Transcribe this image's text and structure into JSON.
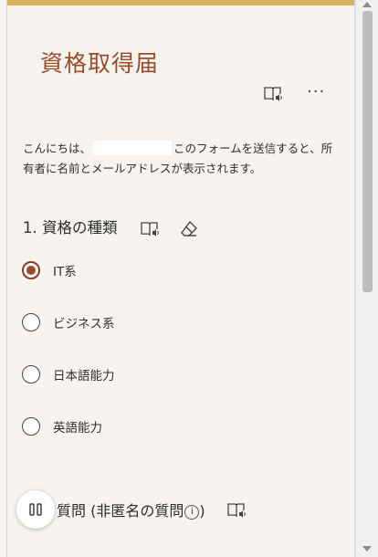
{
  "form": {
    "title": "資格取得届",
    "more_label": "···",
    "intro_prefix": "こんにちは、",
    "intro_suffix": "このフォームを送信すると、所有者に名前とメールアドレスが表示されます。"
  },
  "question1": {
    "title": "1. 資格の種類",
    "options": [
      {
        "label": "IT系",
        "selected": true
      },
      {
        "label": "ビジネス系",
        "selected": false
      },
      {
        "label": "日本語能力",
        "selected": false
      },
      {
        "label": "英語能力",
        "selected": false
      }
    ]
  },
  "question2": {
    "title": "質問 (非匿名の質問",
    "info_glyph": "i",
    "title_suffix": ")"
  },
  "colors": {
    "accent": "#d8b25a",
    "title": "#9a4c2a",
    "radio_selected": "#9a4c2a",
    "background": "#f7f4ef"
  },
  "icons": {
    "immersive_reader": "immersive-reader-icon",
    "more": "more-options-icon",
    "eraser": "eraser-icon",
    "pause": "pause-icon",
    "info": "info-icon"
  }
}
